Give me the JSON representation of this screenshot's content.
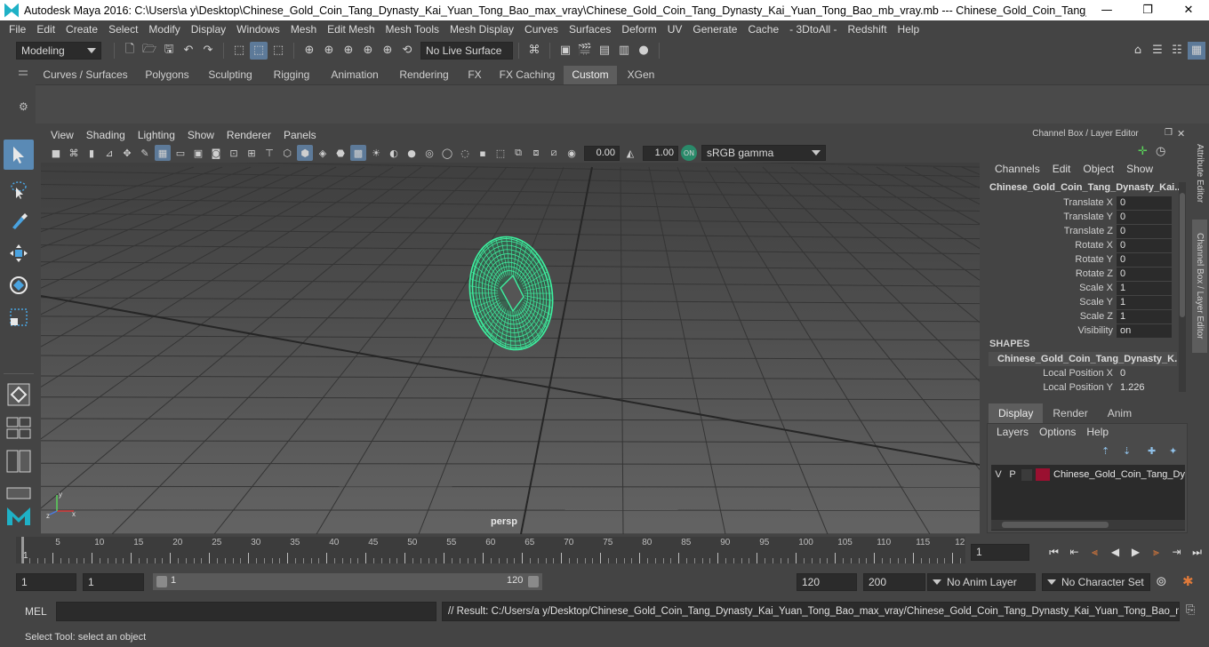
{
  "window": {
    "title": "Autodesk Maya 2016: C:\\Users\\a y\\Desktop\\Chinese_Gold_Coin_Tang_Dynasty_Kai_Yuan_Tong_Bao_max_vray\\Chinese_Gold_Coin_Tang_Dynasty_Kai_Yuan_Tong_Bao_mb_vray.mb   ---   Chinese_Gold_Coin_Tang_Dynasty_Kai_Y...",
    "minimize": "—",
    "maximize": "❐",
    "close": "✕"
  },
  "menubar": [
    "File",
    "Edit",
    "Create",
    "Select",
    "Modify",
    "Display",
    "Windows",
    "Mesh",
    "Edit Mesh",
    "Mesh Tools",
    "Mesh Display",
    "Curves",
    "Surfaces",
    "Deform",
    "UV",
    "Generate",
    "Cache",
    "- 3DtoAll -",
    "Redshift",
    "Help"
  ],
  "statusline": {
    "mode": "Modeling",
    "live_surface": "No Live Surface"
  },
  "shelf": {
    "tabs": [
      "Curves / Surfaces",
      "Polygons",
      "Sculpting",
      "Rigging",
      "Animation",
      "Rendering",
      "FX",
      "FX Caching",
      "Custom",
      "XGen"
    ],
    "active_tab": "Custom"
  },
  "panel": {
    "menu": [
      "View",
      "Shading",
      "Lighting",
      "Show",
      "Renderer",
      "Panels"
    ],
    "exposure": "0.00",
    "gamma": "1.00",
    "color_space": "sRGB gamma",
    "camera": "persp"
  },
  "channel_box": {
    "header": "Channel Box / Layer Editor",
    "menu": [
      "Channels",
      "Edit",
      "Object",
      "Show"
    ],
    "object_name": "Chinese_Gold_Coin_Tang_Dynasty_Kai...",
    "attributes": [
      {
        "name": "Translate X",
        "value": "0"
      },
      {
        "name": "Translate Y",
        "value": "0"
      },
      {
        "name": "Translate Z",
        "value": "0"
      },
      {
        "name": "Rotate X",
        "value": "0"
      },
      {
        "name": "Rotate Y",
        "value": "0"
      },
      {
        "name": "Rotate Z",
        "value": "0"
      },
      {
        "name": "Scale X",
        "value": "1"
      },
      {
        "name": "Scale Y",
        "value": "1"
      },
      {
        "name": "Scale Z",
        "value": "1"
      },
      {
        "name": "Visibility",
        "value": "on"
      }
    ],
    "shapes_label": "SHAPES",
    "shape_name": "Chinese_Gold_Coin_Tang_Dynasty_K...",
    "shape_attributes": [
      {
        "name": "Local Position X",
        "value": "0"
      },
      {
        "name": "Local Position Y",
        "value": "1.226"
      }
    ]
  },
  "layer_editor": {
    "tabs": [
      "Display",
      "Render",
      "Anim"
    ],
    "active_tab": "Display",
    "menu": [
      "Layers",
      "Options",
      "Help"
    ],
    "layer": {
      "v": "V",
      "p": "P",
      "name": "Chinese_Gold_Coin_Tang_Dy",
      "color": "#9a1030"
    }
  },
  "side_tabs": [
    "Attribute Editor",
    "Channel Box / Layer Editor"
  ],
  "timeline": {
    "ticks": [
      "5",
      "10",
      "15",
      "20",
      "25",
      "30",
      "35",
      "40",
      "45",
      "50",
      "55",
      "60",
      "65",
      "70",
      "75",
      "80",
      "85",
      "90",
      "95",
      "100",
      "105",
      "110",
      "115",
      "12"
    ],
    "current_frame_label": "1",
    "current_frame": "1"
  },
  "range": {
    "start": "1",
    "playback_start": "1",
    "slider_start": "1",
    "slider_end": "120",
    "playback_end": "120",
    "end": "200",
    "anim_layer": "No Anim Layer",
    "character_set": "No Character Set"
  },
  "command": {
    "label": "MEL",
    "result": "// Result: C:/Users/a y/Desktop/Chinese_Gold_Coin_Tang_Dynasty_Kai_Yuan_Tong_Bao_max_vray/Chinese_Gold_Coin_Tang_Dynasty_Kai_Yuan_Tong_Bao_mb_vray."
  },
  "help_line": "Select Tool: select an object",
  "colors": {
    "wireframe": "#3ef0a0",
    "accent": "#5a8ab5",
    "viewport_bg": "#5c5c5c"
  }
}
